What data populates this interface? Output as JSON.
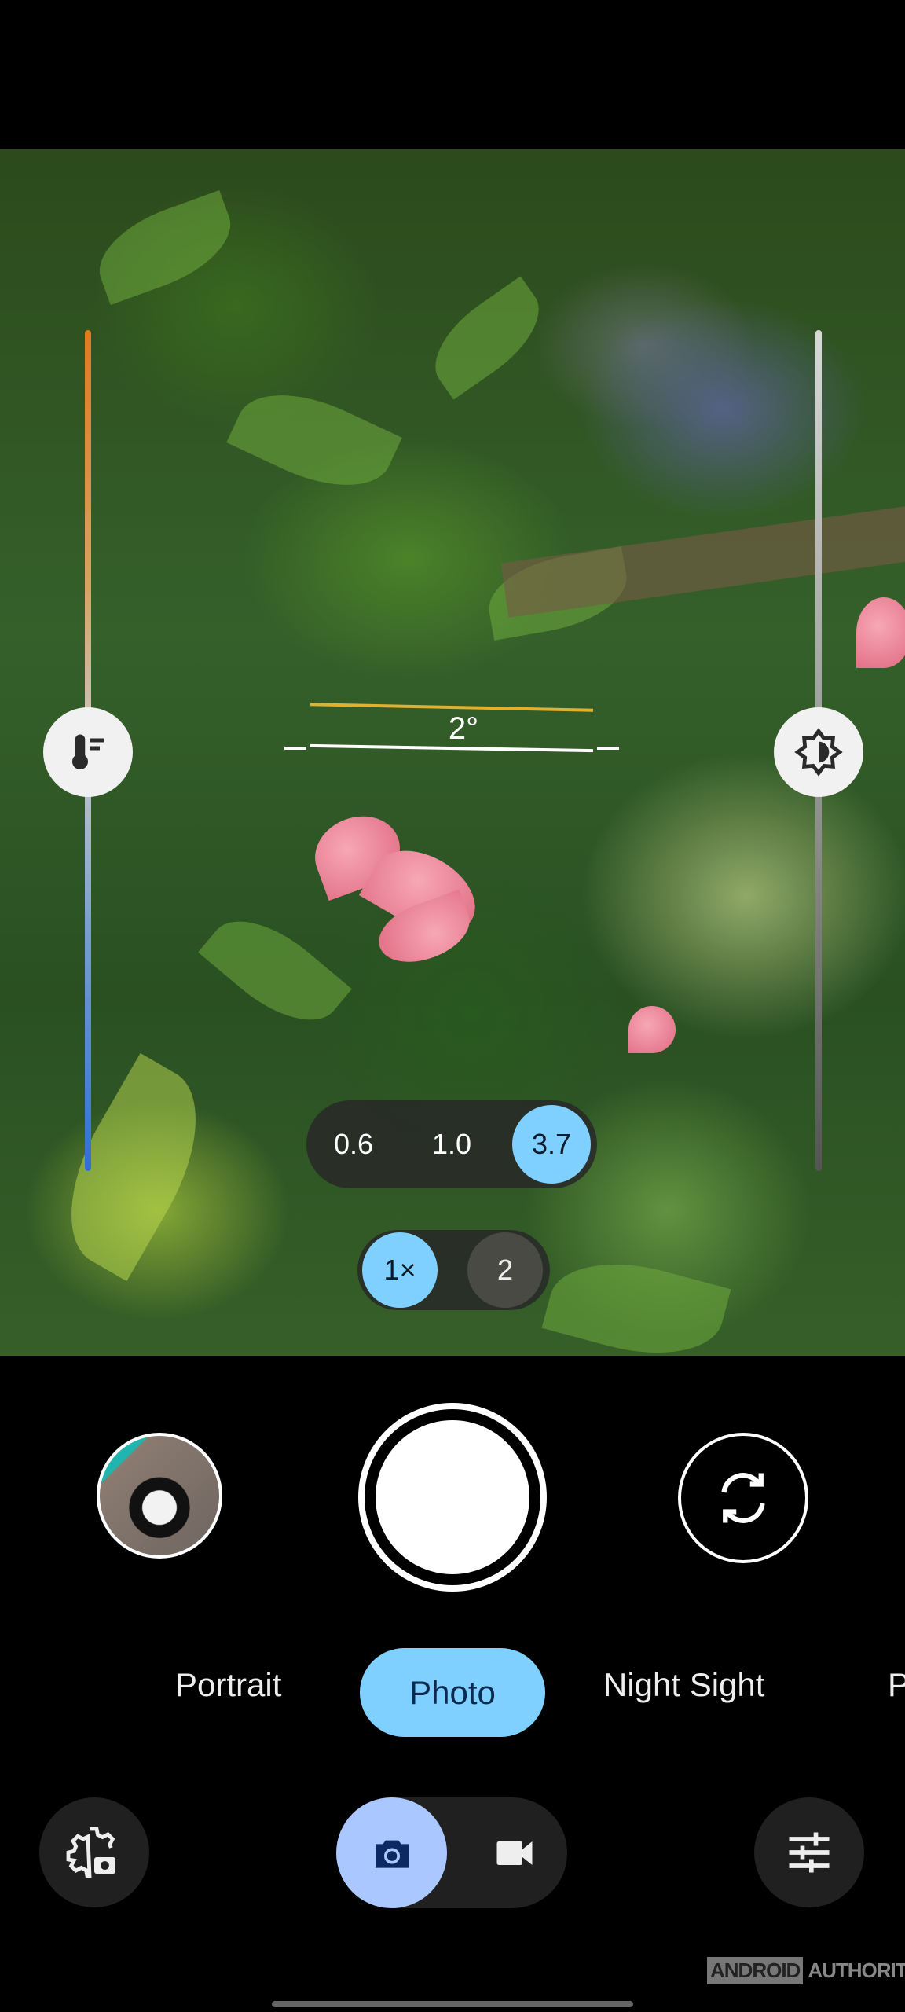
{
  "viewfinder": {
    "level_angle": "2°",
    "white_balance_slider": {
      "icon": "thermometer-icon",
      "level": 0.5
    },
    "brightness_slider": {
      "icon": "brightness-icon",
      "level": 0.5
    }
  },
  "zoom_levels": {
    "options": [
      "0.6",
      "1.0",
      "3.7"
    ],
    "selected": "3.7"
  },
  "zoom_multiplier": {
    "options": [
      "1×",
      "2"
    ],
    "selected": "1×"
  },
  "controls": {
    "gallery_icon": "gallery-thumbnail",
    "shutter_icon": "shutter-button",
    "flip_icon": "flip-camera-icon"
  },
  "modes": {
    "items": [
      "Portrait",
      "Photo",
      "Night Sight",
      "P"
    ],
    "selected": "Photo"
  },
  "bottom_bar": {
    "settings_icon": "camera-settings-icon",
    "photo_icon": "camera-icon",
    "video_icon": "videocam-icon",
    "adjust_icon": "tune-icon"
  },
  "watermark": {
    "part1": "ANDROID",
    "part2": "AUTHORITY"
  },
  "colors": {
    "accent": "#7fd0ff",
    "toggle_active": "#aac7ff",
    "icon_dark": "#0b2a63"
  }
}
